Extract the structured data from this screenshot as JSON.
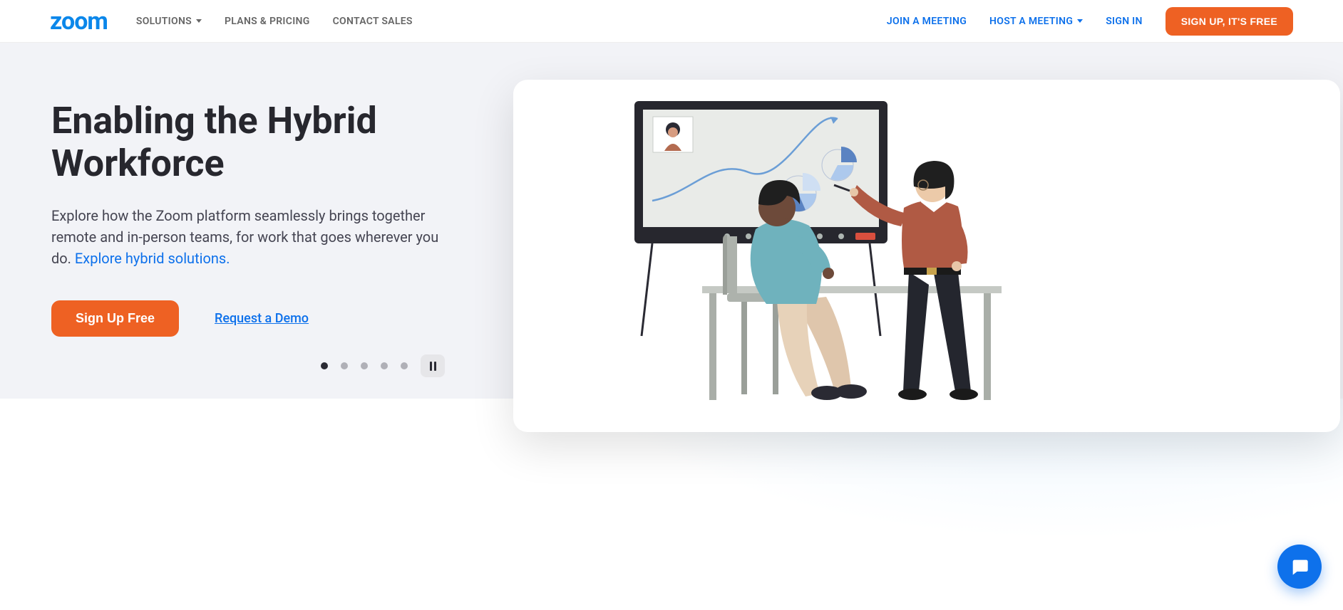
{
  "brand": "zoom",
  "nav": {
    "solutions": "SOLUTIONS",
    "plans": "PLANS & PRICING",
    "contact": "CONTACT SALES",
    "join": "JOIN A MEETING",
    "host": "HOST A MEETING",
    "signin": "SIGN IN",
    "signup": "SIGN UP, IT'S FREE"
  },
  "hero": {
    "title": "Enabling the Hybrid Workforce",
    "copy": "Explore how the Zoom platform seamlessly brings together remote and in-person teams, for work that goes wherever you do. ",
    "explore_link": "Explore hybrid solutions.",
    "cta": "Sign Up Free",
    "demo": "Request a Demo"
  }
}
